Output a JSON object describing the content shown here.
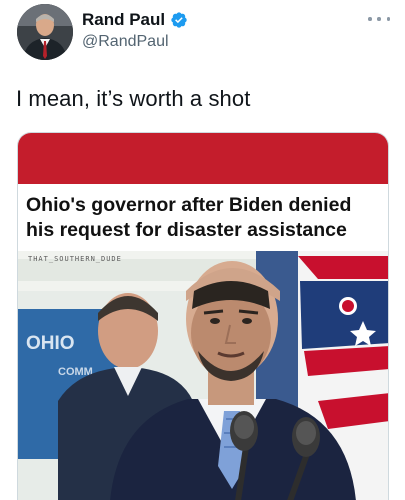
{
  "tweet": {
    "author": {
      "display_name": "Rand Paul",
      "handle": "@RandPaul",
      "verified": true,
      "verified_icon": "verified-badge-icon",
      "verified_color": "#1d9bf0"
    },
    "more_icon": "more-options-icon",
    "text": "I mean, it’s worth a shot"
  },
  "media": {
    "banner_color": "#c41d2c",
    "headline": "Ohio's governor after Biden denied his request for disaster assistance",
    "watermark": "THAT_SOUTHERN_DUDE",
    "sign_text": "OHIO",
    "sign_subtext": "COMM"
  }
}
